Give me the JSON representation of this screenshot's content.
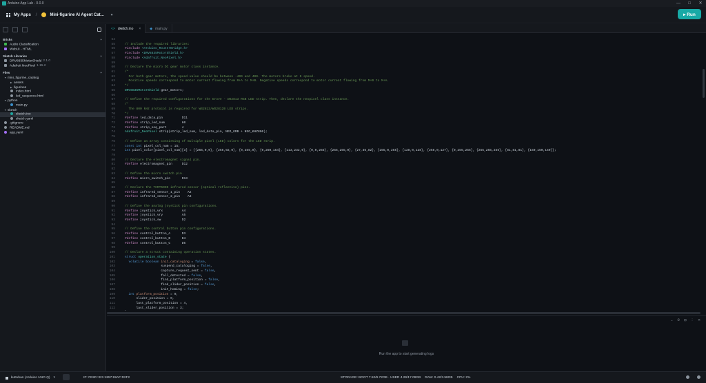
{
  "window": {
    "title": "Arduino App Lab - 0.0.0",
    "controls": [
      "—",
      "□",
      "✕"
    ]
  },
  "header": {
    "my_apps": "My Apps",
    "separator": "/",
    "app_name": "Mini-figurine AI Agent Cat...",
    "run_label": "▸ Run"
  },
  "sidebar": {
    "bricks_title": "Bricks",
    "bricks": [
      {
        "label": "Audio Classification",
        "color": "#3fb950"
      },
      {
        "label": "WebUI - HTML",
        "color": "#a371f7"
      }
    ],
    "libraries_title": "Sketch Libraries",
    "libraries": [
      {
        "label": "DRV8835MotorShield",
        "version": "2.1.0"
      },
      {
        "label": "Adafruit NeoPixel",
        "version": "1.15.2"
      }
    ],
    "files_title": "Files",
    "files": [
      {
        "label": "mini_figurine_catalog",
        "type": "folder",
        "open": true,
        "depth": 0
      },
      {
        "label": "assets",
        "type": "folder",
        "open": false,
        "depth": 1
      },
      {
        "label": "figurines",
        "type": "folder",
        "open": false,
        "depth": 1
      },
      {
        "label": "index.html",
        "type": "file",
        "depth": 1
      },
      {
        "label": "led_sequence.html",
        "type": "file",
        "depth": 1
      },
      {
        "label": "python",
        "type": "folder",
        "open": true,
        "depth": 0
      },
      {
        "label": "main.py",
        "type": "py",
        "depth": 1
      },
      {
        "label": "sketch",
        "type": "folder",
        "open": true,
        "depth": 0
      },
      {
        "label": "sketch.ino",
        "type": "ino",
        "depth": 1,
        "selected": true
      },
      {
        "label": "sketch.yaml",
        "type": "file",
        "depth": 1
      },
      {
        "label": ".gitignore",
        "type": "file",
        "depth": 0
      },
      {
        "label": "README.md",
        "type": "file",
        "depth": 0
      },
      {
        "label": "app.yaml",
        "type": "yaml",
        "depth": 0
      }
    ]
  },
  "tabs": [
    {
      "label": "sketch.ino",
      "icon": "<>",
      "active": true
    },
    {
      "label": "main.py",
      "icon": "◆",
      "active": false
    }
  ],
  "code_lines": [
    [
      {
        "t": "54",
        "c": "ln"
      },
      {
        "t": "",
        "c": "pl"
      }
    ],
    [
      {
        "t": "55",
        "c": "ln"
      },
      {
        "t": "// Include the required libraries:",
        "c": "cm"
      }
    ],
    [
      {
        "t": "56",
        "c": "ln"
      },
      {
        "t": "#include ",
        "c": "pp"
      },
      {
        "t": "<Arduino_RouterBridge.h>",
        "c": "inc"
      }
    ],
    [
      {
        "t": "57",
        "c": "ln"
      },
      {
        "t": "#include ",
        "c": "pp"
      },
      {
        "t": "<DRV8835MotorShield.h>",
        "c": "inc"
      }
    ],
    [
      {
        "t": "58",
        "c": "ln"
      },
      {
        "t": "#include ",
        "c": "pp"
      },
      {
        "t": "<Adafruit_NeoPixel.h>",
        "c": "inc"
      }
    ],
    [
      {
        "t": "59",
        "c": "ln"
      },
      {
        "t": "",
        "c": "pl"
      }
    ],
    [
      {
        "t": "60",
        "c": "ln"
      },
      {
        "t": "// Declare the micro DC gear motor class instance.",
        "c": "cm"
      }
    ],
    [
      {
        "t": "61",
        "c": "ln"
      },
      {
        "t": "/*",
        "c": "cm"
      }
    ],
    [
      {
        "t": "62",
        "c": "ln"
      },
      {
        "t": "  For both gear motors, the speed value should be between -400 and 400. The motors brake at 0 speed.",
        "c": "cm"
      }
    ],
    [
      {
        "t": "63",
        "c": "ln"
      },
      {
        "t": "  Positive speeds correspond to motor current flowing from M+A to M+B. Negative speeds correspond to motor current flowing from M+B to M+A.",
        "c": "cm"
      }
    ],
    [
      {
        "t": "64",
        "c": "ln"
      },
      {
        "t": "*/",
        "c": "cm"
      }
    ],
    [
      {
        "t": "65",
        "c": "ln"
      },
      {
        "t": "DRV8835MotorShield",
        "c": "ty"
      },
      {
        "t": " gear_motors;",
        "c": "pl"
      }
    ],
    [
      {
        "t": "66",
        "c": "ln"
      },
      {
        "t": "",
        "c": "pl"
      }
    ],
    [
      {
        "t": "67",
        "c": "ln"
      },
      {
        "t": "// Define the required configurations for the Grove - WS2813 RGB LED strip. Then, declare the neopixel class instance.",
        "c": "cm"
      }
    ],
    [
      {
        "t": "68",
        "c": "ln"
      },
      {
        "t": "/*",
        "c": "cm"
      }
    ],
    [
      {
        "t": "69",
        "c": "ln"
      },
      {
        "t": "  The 800 kHz protocol is required for WS2813/WS2812B LED strips.",
        "c": "cm"
      }
    ],
    [
      {
        "t": "70",
        "c": "ln"
      },
      {
        "t": "*/",
        "c": "cm"
      }
    ],
    [
      {
        "t": "71",
        "c": "ln"
      },
      {
        "t": "#define ",
        "c": "pp"
      },
      {
        "t": "led_data_pin          D11",
        "c": "pl"
      }
    ],
    [
      {
        "t": "72",
        "c": "ln"
      },
      {
        "t": "#define ",
        "c": "pp"
      },
      {
        "t": "strip_led_num         60",
        "c": "pl"
      }
    ],
    [
      {
        "t": "73",
        "c": "ln"
      },
      {
        "t": "#define ",
        "c": "pp"
      },
      {
        "t": "strip_seq_part        4",
        "c": "pl"
      }
    ],
    [
      {
        "t": "74",
        "c": "ln"
      },
      {
        "t": "Adafruit_NeoPixel",
        "c": "ty"
      },
      {
        "t": " strip(strip_led_num, led_data_pin, NEO_GRB + NEO_KHZ800);",
        "c": "pl"
      }
    ],
    [
      {
        "t": "75",
        "c": "ln"
      },
      {
        "t": "",
        "c": "pl"
      }
    ],
    [
      {
        "t": "76",
        "c": "ln"
      },
      {
        "t": "// Define an array consisting of multiple pixel (LED) colors for the LED strip.",
        "c": "cm"
      }
    ],
    [
      {
        "t": "77",
        "c": "ln"
      },
      {
        "t": "const int ",
        "c": "kw"
      },
      {
        "t": "pixel_col_num = 15;",
        "c": "pl"
      }
    ],
    [
      {
        "t": "78",
        "c": "ln"
      },
      {
        "t": "int ",
        "c": "kw"
      },
      {
        "t": "pixel_color[pixel_col_num][3] = {{255,0,0}, {255,92,0}, {0,255,0}, {0,250,154}, {113,232,0}, {0,0,255}, {255,255,0}, {27,36,82}, {255,0,255}, {128,0,128}, {255,0,127}, {0,255,255}, {255,255,255}, {81,81,81}, {150,150,150}};",
        "c": "pl"
      }
    ],
    [
      {
        "t": "79",
        "c": "ln"
      },
      {
        "t": "",
        "c": "pl"
      }
    ],
    [
      {
        "t": "80",
        "c": "ln"
      },
      {
        "t": "// Declare the electromagnet signal pin.",
        "c": "cm"
      }
    ],
    [
      {
        "t": "81",
        "c": "ln"
      },
      {
        "t": "#define ",
        "c": "pp"
      },
      {
        "t": "electromagnet_pin     D12",
        "c": "pl"
      }
    ],
    [
      {
        "t": "82",
        "c": "ln"
      },
      {
        "t": "",
        "c": "pl"
      }
    ],
    [
      {
        "t": "83",
        "c": "ln"
      },
      {
        "t": "// Define the micro switch pin.",
        "c": "cm"
      }
    ],
    [
      {
        "t": "84",
        "c": "ln"
      },
      {
        "t": "#define ",
        "c": "pp"
      },
      {
        "t": "micro_switch_pin      D13",
        "c": "pl"
      }
    ],
    [
      {
        "t": "85",
        "c": "ln"
      },
      {
        "t": "",
        "c": "pl"
      }
    ],
    [
      {
        "t": "86",
        "c": "ln"
      },
      {
        "t": "// Declare the TCRT5000 infrared sensor (optical reflective) pins.",
        "c": "cm"
      }
    ],
    [
      {
        "t": "87",
        "c": "ln"
      },
      {
        "t": "#define ",
        "c": "pp"
      },
      {
        "t": "infrared_sensor_1_pin    A2",
        "c": "pl"
      }
    ],
    [
      {
        "t": "88",
        "c": "ln"
      },
      {
        "t": "#define ",
        "c": "pp"
      },
      {
        "t": "infrared_sensor_2_pin    A3",
        "c": "pl"
      }
    ],
    [
      {
        "t": "89",
        "c": "ln"
      },
      {
        "t": "",
        "c": "pl"
      }
    ],
    [
      {
        "t": "90",
        "c": "ln"
      },
      {
        "t": "// Define the analog joystick pin configurations.",
        "c": "cm"
      }
    ],
    [
      {
        "t": "91",
        "c": "ln"
      },
      {
        "t": "#define ",
        "c": "pp"
      },
      {
        "t": "joystick_vrx          A4",
        "c": "pl"
      }
    ],
    [
      {
        "t": "92",
        "c": "ln"
      },
      {
        "t": "#define ",
        "c": "pp"
      },
      {
        "t": "joystick_vry          A5",
        "c": "pl"
      }
    ],
    [
      {
        "t": "93",
        "c": "ln"
      },
      {
        "t": "#define ",
        "c": "pp"
      },
      {
        "t": "joystick_sw           D2",
        "c": "pl"
      }
    ],
    [
      {
        "t": "94",
        "c": "ln"
      },
      {
        "t": "",
        "c": "pl"
      }
    ],
    [
      {
        "t": "95",
        "c": "ln"
      },
      {
        "t": "// Define the control button pin configurations.",
        "c": "cm"
      }
    ],
    [
      {
        "t": "96",
        "c": "ln"
      },
      {
        "t": "#define ",
        "c": "pp"
      },
      {
        "t": "control_button_A      D3",
        "c": "pl"
      }
    ],
    [
      {
        "t": "97",
        "c": "ln"
      },
      {
        "t": "#define ",
        "c": "pp"
      },
      {
        "t": "control_button_B      D4",
        "c": "pl"
      }
    ],
    [
      {
        "t": "98",
        "c": "ln"
      },
      {
        "t": "#define ",
        "c": "pp"
      },
      {
        "t": "control_button_C      D5",
        "c": "pl"
      }
    ],
    [
      {
        "t": "99",
        "c": "ln"
      },
      {
        "t": "",
        "c": "pl"
      }
    ],
    [
      {
        "t": "100",
        "c": "ln"
      },
      {
        "t": "// Declare a struct containing operation states.",
        "c": "cm"
      }
    ],
    [
      {
        "t": "101",
        "c": "ln"
      },
      {
        "t": "struct ",
        "c": "kw"
      },
      {
        "t": "operation_state",
        "c": "ty"
      },
      {
        "t": " {",
        "c": "pl"
      }
    ],
    [
      {
        "t": "102",
        "c": "ln"
      },
      {
        "t": "  volatile boolean ",
        "c": "kw"
      },
      {
        "t": "init_cataloging",
        "c": "str"
      },
      {
        "t": " = ",
        "c": "pl"
      },
      {
        "t": "false",
        "c": "kw"
      },
      {
        "t": ",",
        "c": "pl"
      }
    ],
    [
      {
        "t": "103",
        "c": "ln"
      },
      {
        "t": "                   suspend_cataloging = ",
        "c": "pl"
      },
      {
        "t": "false",
        "c": "kw"
      },
      {
        "t": ",",
        "c": "pl"
      }
    ],
    [
      {
        "t": "104",
        "c": "ln"
      },
      {
        "t": "                   capture_request_sent = ",
        "c": "pl"
      },
      {
        "t": "false",
        "c": "kw"
      },
      {
        "t": ",",
        "c": "pl"
      }
    ],
    [
      {
        "t": "105",
        "c": "ln"
      },
      {
        "t": "                   fall_detected = ",
        "c": "pl"
      },
      {
        "t": "false",
        "c": "kw"
      },
      {
        "t": ",",
        "c": "pl"
      }
    ],
    [
      {
        "t": "106",
        "c": "ln"
      },
      {
        "t": "                   find_platform_position = ",
        "c": "pl"
      },
      {
        "t": "false",
        "c": "kw"
      },
      {
        "t": ",",
        "c": "pl"
      }
    ],
    [
      {
        "t": "107",
        "c": "ln"
      },
      {
        "t": "                   find_slider_position = ",
        "c": "pl"
      },
      {
        "t": "false",
        "c": "kw"
      },
      {
        "t": ",",
        "c": "pl"
      }
    ],
    [
      {
        "t": "108",
        "c": "ln"
      },
      {
        "t": "                   init_homing = ",
        "c": "pl"
      },
      {
        "t": "false",
        "c": "kw"
      },
      {
        "t": ";",
        "c": "pl"
      }
    ],
    [
      {
        "t": "109",
        "c": "ln"
      },
      {
        "t": "  int ",
        "c": "kw"
      },
      {
        "t": "platform_position",
        "c": "str"
      },
      {
        "t": " = 0,",
        "c": "pl"
      }
    ],
    [
      {
        "t": "110",
        "c": "ln"
      },
      {
        "t": "      slider_position = 0,",
        "c": "pl"
      }
    ],
    [
      {
        "t": "111",
        "c": "ln"
      },
      {
        "t": "      last_platform_position = 4,",
        "c": "pl"
      }
    ],
    [
      {
        "t": "112",
        "c": "ln"
      },
      {
        "t": "      last_slider_position = 3;",
        "c": "pl"
      }
    ],
    [
      {
        "t": "113",
        "c": "ln"
      },
      {
        "t": "};",
        "c": "pl"
      }
    ]
  ],
  "console": {
    "message": "Run the app to start generating logs",
    "tools": [
      "⌄",
      "⏱",
      "⊟",
      "⋮",
      "✕"
    ]
  },
  "status": {
    "board": "kuttuhan (Arduino UNO Q)",
    "ip": "IP: FE80::321:1857:69AF:D2F2",
    "storage": "STORAGE: BOOT 7.52/9.72GB · USER 4.29/17.09GB",
    "ram": "RAM: 0.42/3.58GB",
    "cpu": "CPU: 2%"
  }
}
